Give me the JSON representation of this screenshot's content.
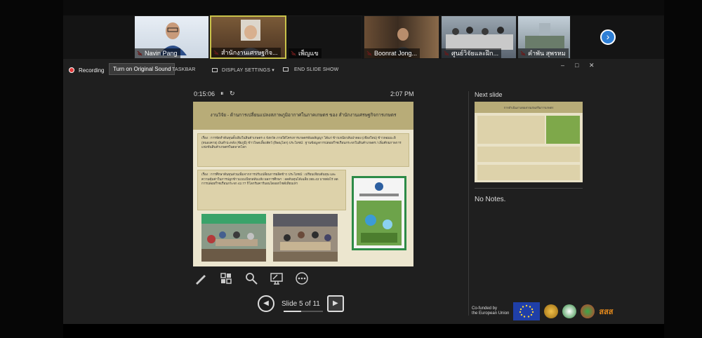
{
  "participants": [
    {
      "name": "Navin Pang",
      "active": false
    },
    {
      "name": "สำนักงานเศรษฐกิจ...",
      "active": true
    },
    {
      "name": "เพ็ญแข",
      "active": false
    },
    {
      "name": "Boonrat Jong...",
      "active": false
    },
    {
      "name": "ศูนย์วิจัยและฝึก...",
      "active": false
    },
    {
      "name": "คำพัน สุพรหม",
      "active": false
    }
  ],
  "recording": {
    "label": "Recording"
  },
  "tooltip": "Turn on Original Sound",
  "toolbar": {
    "taskbar": "TASKBAR",
    "display": "DISPLAY SETTINGS ▾",
    "end": "END SLIDE SHOW"
  },
  "window_controls": [
    "–",
    "□",
    "✕"
  ],
  "timer": {
    "elapsed": "0:15:06",
    "pause": "⏸",
    "reset": "↻",
    "clock": "2:07 PM"
  },
  "slide": {
    "title": "งานวิจัย - ด้านการเปลี่ยนแปลงสภาพภูมิอากาศในภาคเกษตร ของ สำนักงานเศรษฐกิจการเกษตร",
    "box1": "เรื่อง : การจัดทำต้นทุนดั้งเดิมในสินค้าเกษตร 4 จังหวัด ภายใต้โครงการเกษตรพันธสัญญา ได้แก่ ข้าวเหนียวสันป่าตอง (เชียงใหม่) ข้าวหอมมะลิ (หนองคาย) มันสำปะหลัง (ชัยภูมิ) ข้าวโพดเลี้ยงสัตว์ (พิษณุโลก) ประโยชน์ : ฐานข้อมูลการปล่อยก๊าซเรือนกระจกในสินค้าเกษตร / เพิ่มศักยภาพการแข่งขันสินค้าเกษตรในตลาดโลก",
    "box2": "เรื่อง : การศึกษาต้นทุนส่วนเพิ่มจากการปรับเปลี่ยนการผลิตข้าว ประโยชน์ : เปรียบเทียบต้นทุน และความคุ้มค่าในการปลูกข้าวแบบเปียกสลับแห้ง ผลการศึกษา : ลดต้นทุนได้เฉลี่ย 365.43 บาทต่อไร่ ลดการปล่อยก๊าซเรือนกระจก 42.77 กิโลกรัมคาร์บอนไดออกไซด์เทียบเท่า"
  },
  "tools": [
    "pen-icon",
    "grid-icon",
    "zoom-icon",
    "pointer-icon",
    "more-icon"
  ],
  "navigation": {
    "prev": "◀",
    "next": "▶",
    "slide_label": "Slide 5 of 11",
    "progress": 0.45
  },
  "next_slide": {
    "label": "Next slide",
    "title": "การดำเนินงานของกรมส่งเสริมการเกษตร"
  },
  "notes": "No Notes.",
  "footer": {
    "eu_text_1": "Co-funded by",
    "eu_text_2": "the European Union",
    "sss": "สสส"
  },
  "colors": {
    "accent": "#2e7fd6",
    "active_border": "#c9c24a",
    "slide_header": "#b8ac78",
    "slide_bg": "#ece6cf"
  }
}
